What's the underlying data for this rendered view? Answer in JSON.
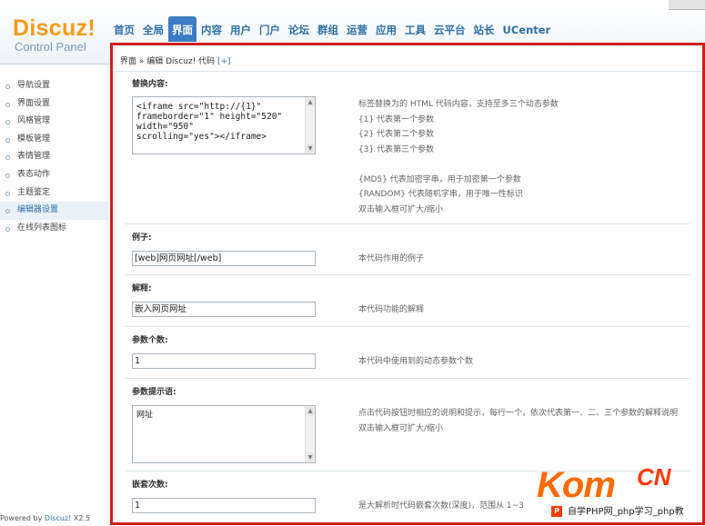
{
  "logo": {
    "main": "Discuz!",
    "sub": "Control Panel"
  },
  "nav": [
    "首页",
    "全局",
    "界面",
    "内容",
    "用户",
    "门户",
    "论坛",
    "群组",
    "运营",
    "应用",
    "工具",
    "云平台",
    "站长",
    "UCenter"
  ],
  "nav_active_index": 2,
  "sidebar": {
    "items": [
      "导航设置",
      "界面设置",
      "风格管理",
      "模板管理",
      "表情管理",
      "表态动作",
      "主题鉴定",
      "编辑器设置",
      "在线列表图标"
    ],
    "active_index": 7
  },
  "powered": {
    "prefix": "Powered by ",
    "brand": "Discuz!",
    "version": " X2.5"
  },
  "breadcrumb": {
    "text": "界面 » 编辑 Discuz! 代码",
    "plus": "[+]"
  },
  "fields": {
    "replace": {
      "label": "替换内容:",
      "value": "<iframe src=\"http://{1}\"\nframeborder=\"1\" height=\"520\"\nwidth=\"950\"\nscrolling=\"yes\"></iframe>",
      "hints": [
        "标签替换为的 HTML 代码内容，支持至多三个动态参数",
        "{1} 代表第一个参数",
        "{2} 代表第二个参数",
        "{3} 代表第三个参数",
        "",
        "{MD5} 代表加密字串，用于加密第一个参数",
        "{RANDOM} 代表随机字串，用于唯一性标识",
        "双击输入框可扩大/缩小"
      ]
    },
    "example": {
      "label": "例子:",
      "value": "[web]网页网址[/web]",
      "hint": "本代码作用的例子"
    },
    "explain": {
      "label": "解释:",
      "value": "嵌入网页网址",
      "hint": "本代码功能的解释"
    },
    "params": {
      "label": "参数个数:",
      "value": "1",
      "hint": "本代码中使用到的动态参数个数"
    },
    "prompt": {
      "label": "参数提示语:",
      "value": "网址",
      "hints": [
        "点击代码按钮时相应的说明和提示，每行一个，依次代表第一、二、三个参数的解释说明",
        "双击输入框可扩大/缩小"
      ]
    },
    "nest": {
      "label": "嵌套次数:",
      "value": "1",
      "hint": "是大解析时代码嵌套次数(深度)，范围从 1~3"
    }
  },
  "watermark": {
    "k": "Kom",
    "cn": "CN",
    "bar": "自学PHP网_php学习_php教"
  }
}
